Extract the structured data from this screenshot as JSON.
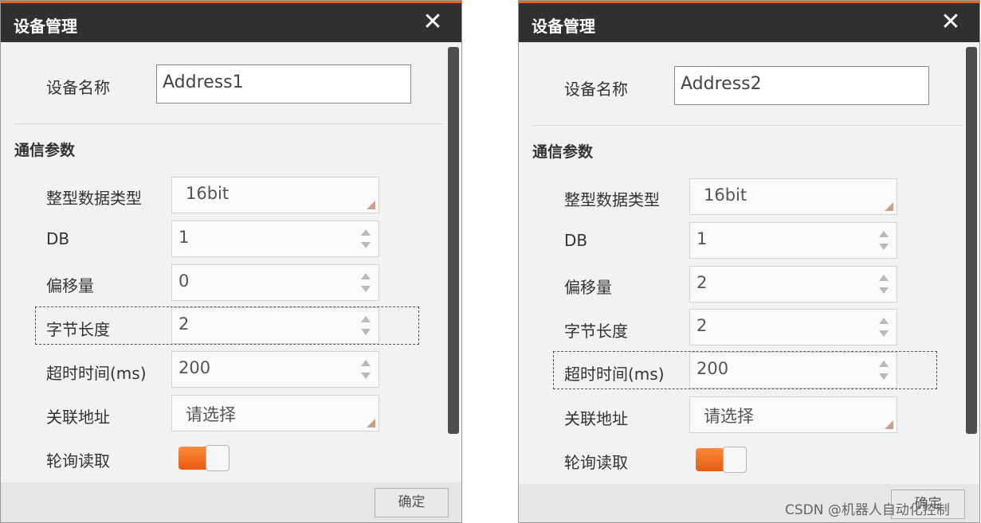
{
  "dialogs": [
    {
      "title": "设备管理",
      "close_glyph": "✕",
      "device_name_label": "设备名称",
      "device_name_value": "Address1",
      "section_title": "通信参数",
      "int_type_label": "整型数据类型",
      "int_type_value": "16bit",
      "db_label": "DB",
      "db_value": "1",
      "offset_label": "偏移量",
      "offset_value": "0",
      "byte_length_label": "字节长度",
      "byte_length_value": "2",
      "timeout_label": "超时时间(ms)",
      "timeout_value": "200",
      "linked_address_label": "关联地址",
      "linked_address_placeholder": "请选择",
      "polling_label": "轮询读取",
      "polling_enabled": true,
      "ok_label": "确定",
      "focused_field": "byte_length"
    },
    {
      "title": "设备管理",
      "close_glyph": "✕",
      "device_name_label": "设备名称",
      "device_name_value": "Address2",
      "section_title": "通信参数",
      "int_type_label": "整型数据类型",
      "int_type_value": "16bit",
      "db_label": "DB",
      "db_value": "1",
      "offset_label": "偏移量",
      "offset_value": "2",
      "byte_length_label": "字节长度",
      "byte_length_value": "2",
      "timeout_label": "超时时间(ms)",
      "timeout_value": "200",
      "linked_address_label": "关联地址",
      "linked_address_placeholder": "请选择",
      "polling_label": "轮询读取",
      "polling_enabled": true,
      "ok_label": "确定",
      "focused_field": "timeout"
    }
  ],
  "watermark": "CSDN @机器人自动化控制",
  "colors": {
    "titlebar": "#303030",
    "accent": "#e0681e",
    "toggle_on": "#f07020"
  },
  "icons": {
    "close": "close-icon",
    "spinner": "spinner-arrows-icon",
    "dropdown_corner": "dropdown-corner-icon"
  }
}
